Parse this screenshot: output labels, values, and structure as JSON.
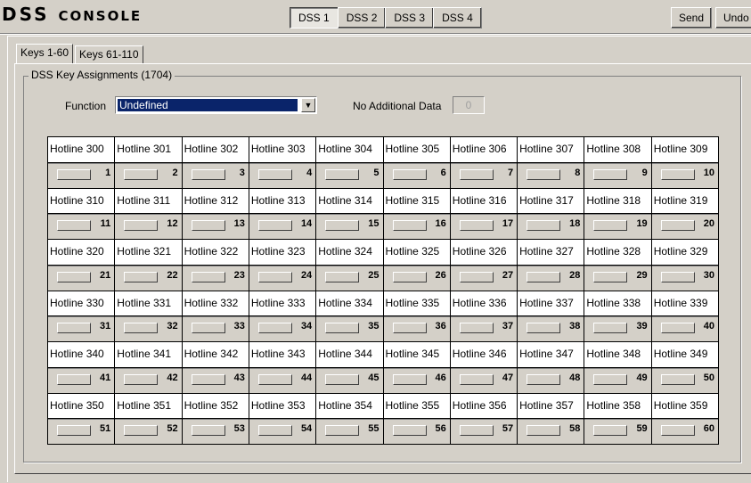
{
  "app": {
    "title_prefix": "DSS",
    "title_suffix": "Console"
  },
  "dss_tabs": [
    "DSS 1",
    "DSS 2",
    "DSS 3",
    "DSS 4"
  ],
  "active_dss_tab": 0,
  "toolbar": {
    "send_label": "Send",
    "undo_label": "Undo"
  },
  "page_tabs": [
    "Keys 1-60",
    "Keys 61-110"
  ],
  "group": {
    "legend": "DSS Key Assignments (1704)",
    "function_label": "Function",
    "function_value": "Undefined",
    "no_additional_label": "No Additional Data",
    "no_additional_value": "0"
  },
  "keys": [
    {
      "label": "Hotline 300",
      "num": "1"
    },
    {
      "label": "Hotline 301",
      "num": "2"
    },
    {
      "label": "Hotline 302",
      "num": "3"
    },
    {
      "label": "Hotline 303",
      "num": "4"
    },
    {
      "label": "Hotline 304",
      "num": "5"
    },
    {
      "label": "Hotline 305",
      "num": "6"
    },
    {
      "label": "Hotline 306",
      "num": "7"
    },
    {
      "label": "Hotline 307",
      "num": "8"
    },
    {
      "label": "Hotline 308",
      "num": "9"
    },
    {
      "label": "Hotline 309",
      "num": "10"
    },
    {
      "label": "Hotline 310",
      "num": "11"
    },
    {
      "label": "Hotline 311",
      "num": "12"
    },
    {
      "label": "Hotline 312",
      "num": "13"
    },
    {
      "label": "Hotline 313",
      "num": "14"
    },
    {
      "label": "Hotline 314",
      "num": "15"
    },
    {
      "label": "Hotline 315",
      "num": "16"
    },
    {
      "label": "Hotline 316",
      "num": "17"
    },
    {
      "label": "Hotline 317",
      "num": "18"
    },
    {
      "label": "Hotline 318",
      "num": "19"
    },
    {
      "label": "Hotline 319",
      "num": "20"
    },
    {
      "label": "Hotline 320",
      "num": "21"
    },
    {
      "label": "Hotline 321",
      "num": "22"
    },
    {
      "label": "Hotline 322",
      "num": "23"
    },
    {
      "label": "Hotline 323",
      "num": "24"
    },
    {
      "label": "Hotline 324",
      "num": "25"
    },
    {
      "label": "Hotline 325",
      "num": "26"
    },
    {
      "label": "Hotline 326",
      "num": "27"
    },
    {
      "label": "Hotline 327",
      "num": "28"
    },
    {
      "label": "Hotline 328",
      "num": "29"
    },
    {
      "label": "Hotline 329",
      "num": "30"
    },
    {
      "label": "Hotline 330",
      "num": "31"
    },
    {
      "label": "Hotline 331",
      "num": "32"
    },
    {
      "label": "Hotline 332",
      "num": "33"
    },
    {
      "label": "Hotline 333",
      "num": "34"
    },
    {
      "label": "Hotline 334",
      "num": "35"
    },
    {
      "label": "Hotline 335",
      "num": "36"
    },
    {
      "label": "Hotline 336",
      "num": "37"
    },
    {
      "label": "Hotline 337",
      "num": "38"
    },
    {
      "label": "Hotline 338",
      "num": "39"
    },
    {
      "label": "Hotline 339",
      "num": "40"
    },
    {
      "label": "Hotline 340",
      "num": "41"
    },
    {
      "label": "Hotline 341",
      "num": "42"
    },
    {
      "label": "Hotline 342",
      "num": "43"
    },
    {
      "label": "Hotline 343",
      "num": "44"
    },
    {
      "label": "Hotline 344",
      "num": "45"
    },
    {
      "label": "Hotline 345",
      "num": "46"
    },
    {
      "label": "Hotline 346",
      "num": "47"
    },
    {
      "label": "Hotline 347",
      "num": "48"
    },
    {
      "label": "Hotline 348",
      "num": "49"
    },
    {
      "label": "Hotline 349",
      "num": "50"
    },
    {
      "label": "Hotline 350",
      "num": "51"
    },
    {
      "label": "Hotline 351",
      "num": "52"
    },
    {
      "label": "Hotline 352",
      "num": "53"
    },
    {
      "label": "Hotline 353",
      "num": "54"
    },
    {
      "label": "Hotline 354",
      "num": "55"
    },
    {
      "label": "Hotline 355",
      "num": "56"
    },
    {
      "label": "Hotline 356",
      "num": "57"
    },
    {
      "label": "Hotline 357",
      "num": "58"
    },
    {
      "label": "Hotline 358",
      "num": "59"
    },
    {
      "label": "Hotline 359",
      "num": "60"
    }
  ],
  "colors": {
    "face": "#d4d0c8",
    "select_highlight": "#0a246a"
  }
}
